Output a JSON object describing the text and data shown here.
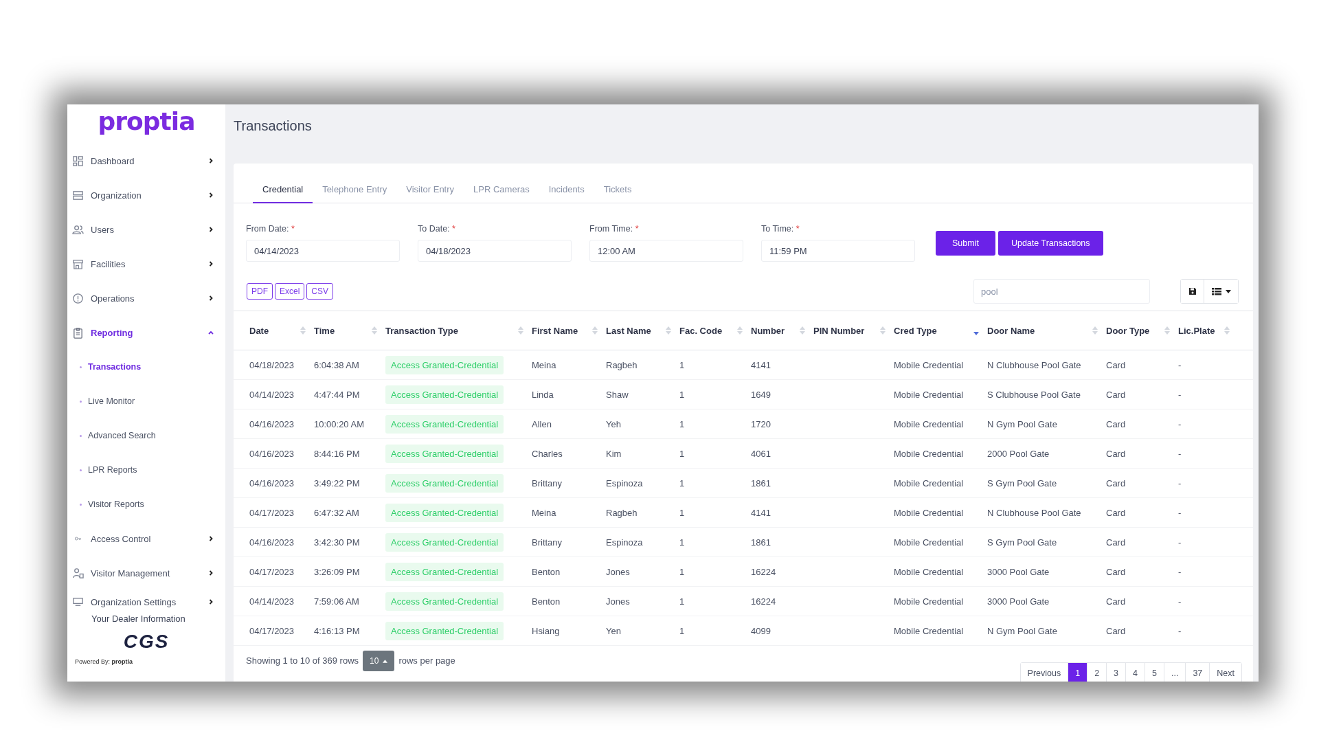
{
  "brand": {
    "logo": "proptia"
  },
  "nav": [
    {
      "label": "Dashboard",
      "expanded": false,
      "selected": false
    },
    {
      "label": "Organization",
      "expanded": false,
      "selected": false
    },
    {
      "label": "Users",
      "expanded": false,
      "selected": false
    },
    {
      "label": "Facilities",
      "expanded": false,
      "selected": false
    },
    {
      "label": "Operations",
      "expanded": false,
      "selected": false
    },
    {
      "label": "Reporting",
      "expanded": true,
      "selected": true,
      "children": [
        {
          "label": "Transactions",
          "selected": true
        },
        {
          "label": "Live Monitor",
          "selected": false
        },
        {
          "label": "Advanced Search",
          "selected": false
        },
        {
          "label": "LPR Reports",
          "selected": false
        },
        {
          "label": "Visitor Reports",
          "selected": false
        }
      ]
    },
    {
      "label": "Access Control",
      "expanded": false,
      "selected": false
    },
    {
      "label": "Visitor Management",
      "expanded": false,
      "selected": false
    },
    {
      "label": "Organization Settings",
      "expanded": false,
      "selected": false
    }
  ],
  "sidebar_footer": {
    "dealer_info": "Your Dealer Information",
    "dealer_logo": "CGS",
    "powered_by": "Powered By:",
    "powered_brand": "proptia"
  },
  "page_title": "Transactions",
  "tabs": [
    {
      "label": "Credential",
      "selected": true
    },
    {
      "label": "Telephone Entry",
      "selected": false
    },
    {
      "label": "Visitor Entry",
      "selected": false
    },
    {
      "label": "LPR Cameras",
      "selected": false
    },
    {
      "label": "Incidents",
      "selected": false
    },
    {
      "label": "Tickets",
      "selected": false
    }
  ],
  "filters": [
    {
      "label": "From Date:",
      "required_mark": "*",
      "value": "04/14/2023"
    },
    {
      "label": "To Date:",
      "required_mark": "*",
      "value": "04/18/2023"
    },
    {
      "label": "From Time:",
      "required_mark": "*",
      "value": "12:00 AM"
    },
    {
      "label": "To Time:",
      "required_mark": "*",
      "value": "11:59 PM"
    }
  ],
  "buttons": [
    "Submit",
    "Update Transactions"
  ],
  "exports": [
    "PDF",
    "Excel",
    "CSV"
  ],
  "search": {
    "value": "pool"
  },
  "table": {
    "columns": [
      {
        "label": "Date",
        "sorted": false
      },
      {
        "label": "Time",
        "sorted": false
      },
      {
        "label": "Transaction Type",
        "sorted": false
      },
      {
        "label": "First Name",
        "sorted": false
      },
      {
        "label": "Last Name",
        "sorted": false
      },
      {
        "label": "Fac. Code",
        "sorted": false
      },
      {
        "label": "Number",
        "sorted": false
      },
      {
        "label": "PIN Number",
        "sorted": false
      },
      {
        "label": "Cred Type",
        "sorted": true
      },
      {
        "label": "Door Name",
        "sorted": false
      },
      {
        "label": "Door Type",
        "sorted": false
      },
      {
        "label": "Lic.Plate",
        "sorted": false
      }
    ],
    "rows": [
      [
        "04/18/2023",
        "6:04:38 AM",
        "Access Granted-Credential",
        "Meina",
        "Ragbeh",
        "1",
        "4141",
        "",
        "Mobile Credential",
        "N Clubhouse Pool Gate",
        "Card",
        "-"
      ],
      [
        "04/14/2023",
        "4:47:44 PM",
        "Access Granted-Credential",
        "Linda",
        "Shaw",
        "1",
        "1649",
        "",
        "Mobile Credential",
        "S Clubhouse Pool Gate",
        "Card",
        "-"
      ],
      [
        "04/16/2023",
        "10:00:20 AM",
        "Access Granted-Credential",
        "Allen",
        "Yeh",
        "1",
        "1720",
        "",
        "Mobile Credential",
        "N Gym Pool Gate",
        "Card",
        "-"
      ],
      [
        "04/16/2023",
        "8:44:16 PM",
        "Access Granted-Credential",
        "Charles",
        "Kim",
        "1",
        "4061",
        "",
        "Mobile Credential",
        "2000 Pool Gate",
        "Card",
        "-"
      ],
      [
        "04/16/2023",
        "3:49:22 PM",
        "Access Granted-Credential",
        "Brittany",
        "Espinoza",
        "1",
        "1861",
        "",
        "Mobile Credential",
        "S Gym Pool Gate",
        "Card",
        "-"
      ],
      [
        "04/17/2023",
        "6:47:32 AM",
        "Access Granted-Credential",
        "Meina",
        "Ragbeh",
        "1",
        "4141",
        "",
        "Mobile Credential",
        "N Clubhouse Pool Gate",
        "Card",
        "-"
      ],
      [
        "04/16/2023",
        "3:42:30 PM",
        "Access Granted-Credential",
        "Brittany",
        "Espinoza",
        "1",
        "1861",
        "",
        "Mobile Credential",
        "S Gym Pool Gate",
        "Card",
        "-"
      ],
      [
        "04/17/2023",
        "3:26:09 PM",
        "Access Granted-Credential",
        "Benton",
        "Jones",
        "1",
        "16224",
        "",
        "Mobile Credential",
        "3000 Pool Gate",
        "Card",
        "-"
      ],
      [
        "04/14/2023",
        "7:59:06 AM",
        "Access Granted-Credential",
        "Benton",
        "Jones",
        "1",
        "16224",
        "",
        "Mobile Credential",
        "3000 Pool Gate",
        "Card",
        "-"
      ],
      [
        "04/17/2023",
        "4:16:13 PM",
        "Access Granted-Credential",
        "Hsiang",
        "Yen",
        "1",
        "4099",
        "",
        "Mobile Credential",
        "N Gym Pool Gate",
        "Card",
        "-"
      ]
    ]
  },
  "footer": {
    "showing": "Showing 1 to 10 of 369 rows",
    "page_size": "10",
    "per_page": "rows per page"
  },
  "pagination": {
    "previous": "Previous",
    "pages": [
      {
        "label": "1",
        "selected": true
      },
      {
        "label": "2",
        "selected": false
      },
      {
        "label": "3",
        "selected": false
      },
      {
        "label": "4",
        "selected": false
      },
      {
        "label": "5",
        "selected": false
      },
      {
        "label": "...",
        "selected": false
      },
      {
        "label": "37",
        "selected": false
      }
    ],
    "next": "Next"
  }
}
